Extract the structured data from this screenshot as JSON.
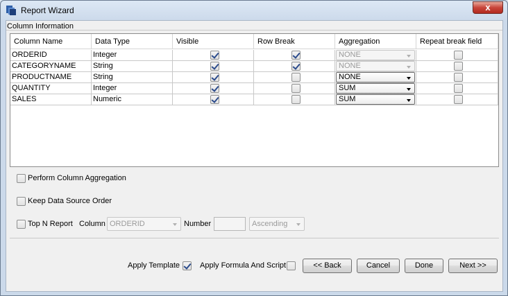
{
  "window": {
    "title": "Report Wizard",
    "close_symbol": "x"
  },
  "group": {
    "label": "Column Information"
  },
  "table": {
    "headers": [
      "Column Name",
      "Data Type",
      "Visible",
      "Row Break",
      "Aggregation",
      "Repeat break field"
    ],
    "rows": [
      {
        "name": "ORDERID",
        "type": "Integer",
        "visible": true,
        "row_break": true,
        "aggregation": "NONE",
        "aggregation_enabled": false,
        "repeat": false
      },
      {
        "name": "CATEGORYNAME",
        "type": "String",
        "visible": true,
        "row_break": true,
        "aggregation": "NONE",
        "aggregation_enabled": false,
        "repeat": false
      },
      {
        "name": "PRODUCTNAME",
        "type": "String",
        "visible": true,
        "row_break": false,
        "aggregation": "NONE",
        "aggregation_enabled": true,
        "repeat": false
      },
      {
        "name": "QUANTITY",
        "type": "Integer",
        "visible": true,
        "row_break": false,
        "aggregation": "SUM",
        "aggregation_enabled": true,
        "repeat": false
      },
      {
        "name": "SALES",
        "type": "Numeric",
        "visible": true,
        "row_break": false,
        "aggregation": "SUM",
        "aggregation_enabled": true,
        "repeat": false
      }
    ]
  },
  "options": {
    "perform_aggregation": {
      "label": "Perform Column Aggregation",
      "checked": false
    },
    "keep_order": {
      "label": "Keep Data Source Order",
      "checked": false
    },
    "top_n": {
      "label": "Top N Report",
      "checked": false,
      "column_label": "Column",
      "column_value": "ORDERID",
      "number_label": "Number",
      "number_value": "",
      "order_value": "Ascending"
    }
  },
  "footer": {
    "apply_template": {
      "label": "Apply Template",
      "checked": true
    },
    "apply_formula": {
      "label": "Apply Formula And Script",
      "checked": false
    },
    "back_label": "<< Back",
    "cancel_label": "Cancel",
    "done_label": "Done",
    "next_label": "Next >>"
  },
  "colors": {
    "title_bg": "#cbd9ea",
    "close_button": "#c8453a",
    "check_mark": "#2b4b8c"
  }
}
